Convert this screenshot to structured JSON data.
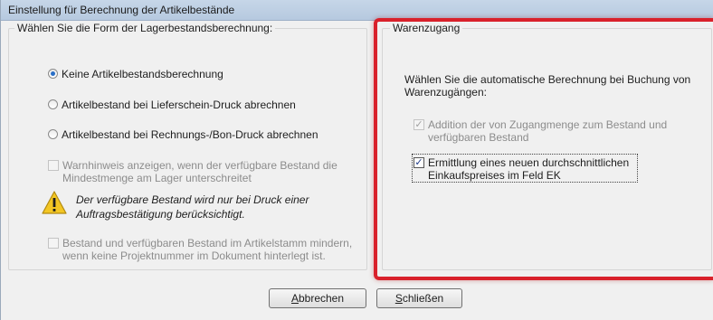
{
  "window": {
    "title": "Einstellung für Berechnung der Artikelbestände"
  },
  "left_group": {
    "legend": "Wählen Sie die Form der Lagerbestandsberechnung:",
    "options": [
      {
        "label": "Keine Artikelbestandsberechnung",
        "selected": true
      },
      {
        "label": "Artikelbestand bei Lieferschein-Druck abrechnen",
        "selected": false
      },
      {
        "label": "Artikelbestand bei Rechnungs-/Bon-Druck abrechnen",
        "selected": false
      }
    ],
    "warn_checkbox": {
      "label": "Warnhinweis anzeigen, wenn der verfügbare Bestand die Mindestmenge am Lager unterschreitet",
      "checked": false,
      "enabled": false
    },
    "note": "Der verfügbare Bestand wird nur bei Druck einer Auftragsbestätigung berücksichtigt.",
    "note_icon": "warning-icon",
    "reduce_checkbox": {
      "label": "Bestand und verfügbaren Bestand im Artikelstamm mindern, wenn keine Projektnummer im Dokument hinterlegt ist.",
      "checked": false,
      "enabled": false
    }
  },
  "right_group": {
    "legend": "Warenzugang",
    "description": "Wählen Sie die automatische Berechnung bei Buchung von Warenzugängen:",
    "checkboxes": [
      {
        "label": "Addition der von Zugangmenge zum Bestand und verfügbaren Bestand",
        "checked": true,
        "enabled": false
      },
      {
        "label": "Ermittlung eines neuen durchschnittlichen Einkaufspreises im Feld EK",
        "checked": true,
        "enabled": true
      }
    ]
  },
  "buttons": {
    "cancel_pre": "",
    "cancel_key": "A",
    "cancel_rest": "bbrechen",
    "close_pre": "",
    "close_key": "S",
    "close_rest": "chließen"
  },
  "colors": {
    "highlight": "#d9212b",
    "accent": "#2a6fc7"
  }
}
